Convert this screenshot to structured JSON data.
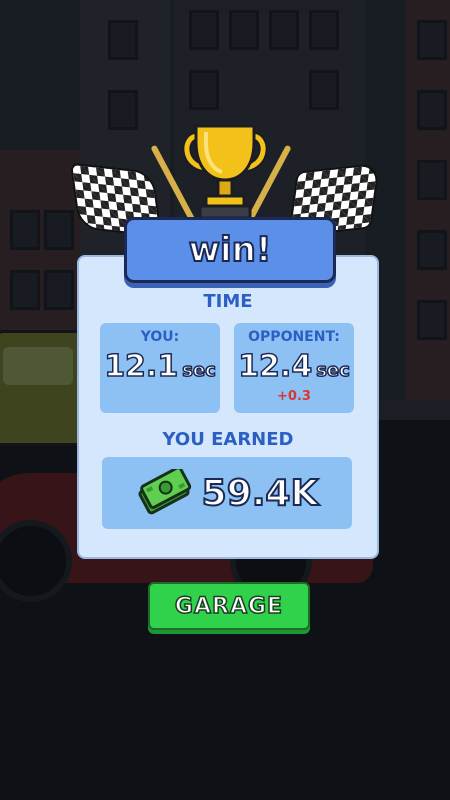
{
  "result": {
    "title": "win!"
  },
  "time": {
    "label": "TIME",
    "you": {
      "caption": "YOU:",
      "value": "12.1",
      "unit": "sec"
    },
    "opponent": {
      "caption": "OPPONENT:",
      "value": "12.4",
      "unit": "sec",
      "delta": "+0.3"
    }
  },
  "earnings": {
    "label": "YOU EARNED",
    "amount": "59.4K",
    "icon": "cash-stack-icon"
  },
  "actions": {
    "garage_label": "GARAGE"
  },
  "colors": {
    "panel": "#d4e7fc",
    "card": "#8dc1f4",
    "label_blue": "#2b5fc4",
    "banner": "#5b8fe8",
    "button_green": "#2fd24a",
    "delta_red": "#d9372f",
    "trophy_gold": "#f2c21a"
  }
}
